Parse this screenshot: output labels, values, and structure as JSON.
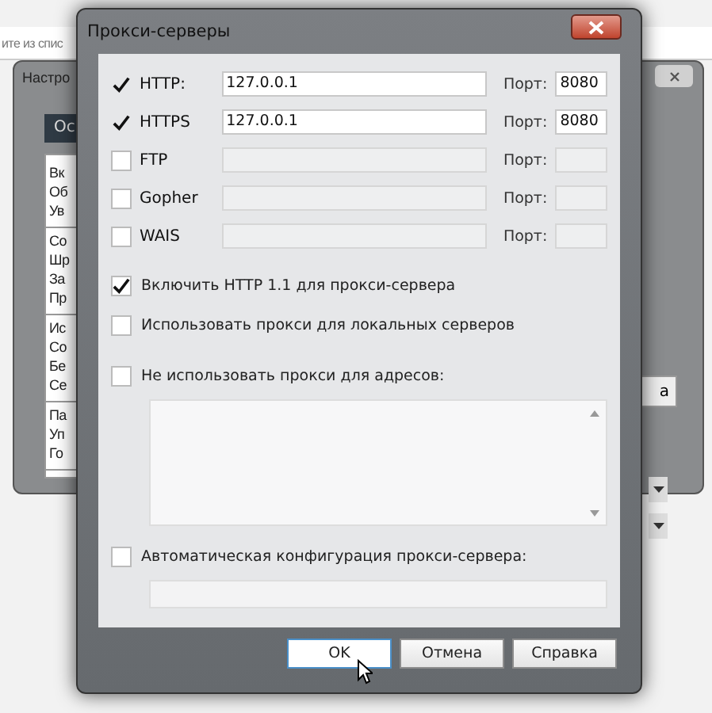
{
  "background": {
    "address_fragment": "ите из спис",
    "window": {
      "title": "Настро",
      "tab": "Ос",
      "list_groups": [
        [
          "Вк",
          "Об",
          "Ув"
        ],
        [
          "Со",
          "Шр",
          "За",
          "Пр"
        ],
        [
          "Ис",
          "Со",
          "Бе",
          "Се"
        ],
        [
          "Па",
          "Уп",
          "Го"
        ]
      ],
      "button_fragment": "а"
    }
  },
  "dialog": {
    "title": "Прокси-серверы",
    "proxies": [
      {
        "protocol": "HTTP:",
        "checked": true,
        "address": "127.0.0.1",
        "port_label": "Порт:",
        "port": "8080"
      },
      {
        "protocol": "HTTPS",
        "checked": true,
        "address": "127.0.0.1",
        "port_label": "Порт:",
        "port": "8080"
      },
      {
        "protocol": "FTP",
        "checked": false,
        "port_label": "Порт:"
      },
      {
        "protocol": "Gopher",
        "checked": false,
        "port_label": "Порт:"
      },
      {
        "protocol": "WAIS",
        "checked": false,
        "port_label": "Порт:"
      }
    ],
    "options": [
      {
        "label": "Включить HTTP 1.1 для прокси-сервера",
        "checked": true
      },
      {
        "label": "Использовать прокси для локальных серверов",
        "checked": false
      }
    ],
    "bypass": {
      "label": "Не использовать прокси для адресов:",
      "checked": false
    },
    "autoconfig": {
      "label": "Автоматическая конфигурация прокси-сервера:",
      "checked": false
    },
    "buttons": [
      "OK",
      "Отмена",
      "Справка"
    ]
  }
}
